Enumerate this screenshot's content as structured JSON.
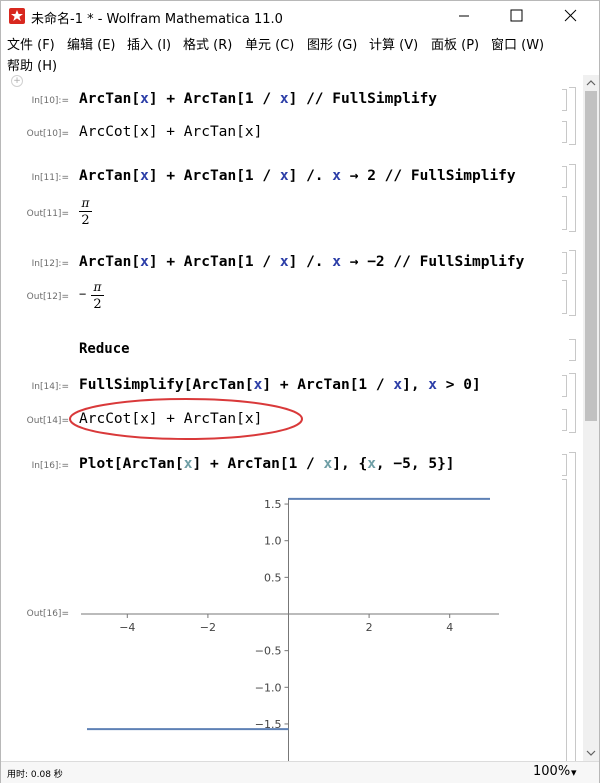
{
  "window": {
    "title": "未命名-1 * - Wolfram Mathematica 11.0",
    "minimize": "—",
    "maximize": "☐",
    "close": "✕"
  },
  "menu": [
    "文件 (F)",
    "编辑 (E)",
    "插入 (I)",
    "格式 (R)",
    "单元 (C)",
    "图形 (G)",
    "计算 (V)",
    "面板 (P)",
    "窗口 (W)",
    "帮助 (H)"
  ],
  "cells": {
    "in10": {
      "label": "In[10]:="
    },
    "out10": {
      "label": "Out[10]=",
      "text": "ArcCot[x] + ArcTan[x]"
    },
    "in11": {
      "label": "In[11]:="
    },
    "out11": {
      "label": "Out[11]=",
      "num": "π",
      "den": "2"
    },
    "in12": {
      "label": "In[12]:="
    },
    "out12": {
      "label": "Out[12]=",
      "sign": "−",
      "num": "π",
      "den": "2"
    },
    "reduce": {
      "text": "Reduce"
    },
    "in14": {
      "label": "In[14]:="
    },
    "out14": {
      "label": "Out[14]=",
      "text": "ArcCot[x] + ArcTan[x]"
    },
    "in16": {
      "label": "In[16]:="
    },
    "out16": {
      "label": "Out[16]="
    }
  },
  "code_tokens": {
    "arctan": "ArcTan",
    "x": "x",
    "one": "1",
    "slash": "/",
    "lb": "[",
    "rb": "]",
    "plus": "+",
    "postfix": "//",
    "fullsimplify": "FullSimplify",
    "replace": "/.",
    "arrow": "→",
    "two": "2",
    "neg_two": "−2",
    "comma": ",",
    "gt": ">",
    "zero": "0",
    "plot": "Plot",
    "lbrace": "{",
    "rbrace": "}",
    "neg_five": "−5",
    "five": "5"
  },
  "status": {
    "elapsed": "用时: 0.08 秒",
    "zoom": "100%",
    "zoom_arrow": "▾"
  },
  "colors": {
    "annotation_ellipse": "#d9393a",
    "plot_line": "#5e81b5",
    "symbol_blue": "#2d3fa8",
    "local_var": "#6f9fa6"
  },
  "chart_data": {
    "type": "line",
    "title": "",
    "xlabel": "",
    "ylabel": "",
    "xlim": [
      -5,
      5
    ],
    "ylim": [
      -1.65,
      1.65
    ],
    "x_ticks": [
      -4,
      -2,
      2,
      4
    ],
    "y_ticks": [
      1.5,
      1.0,
      0.5,
      -0.5,
      -1.0,
      -1.5
    ],
    "x_tick_labels": [
      "−4",
      "−2",
      "2",
      "4"
    ],
    "y_tick_labels": [
      "1.5",
      "1.0",
      "0.5",
      "−0.5",
      "−1.0",
      "−1.5"
    ],
    "series": [
      {
        "values": [
          [
            -5,
            -1.5708
          ],
          [
            0,
            -1.5708
          ]
        ]
      },
      {
        "values": [
          [
            0,
            1.5708
          ],
          [
            5,
            1.5708
          ]
        ]
      }
    ],
    "grid": false
  }
}
